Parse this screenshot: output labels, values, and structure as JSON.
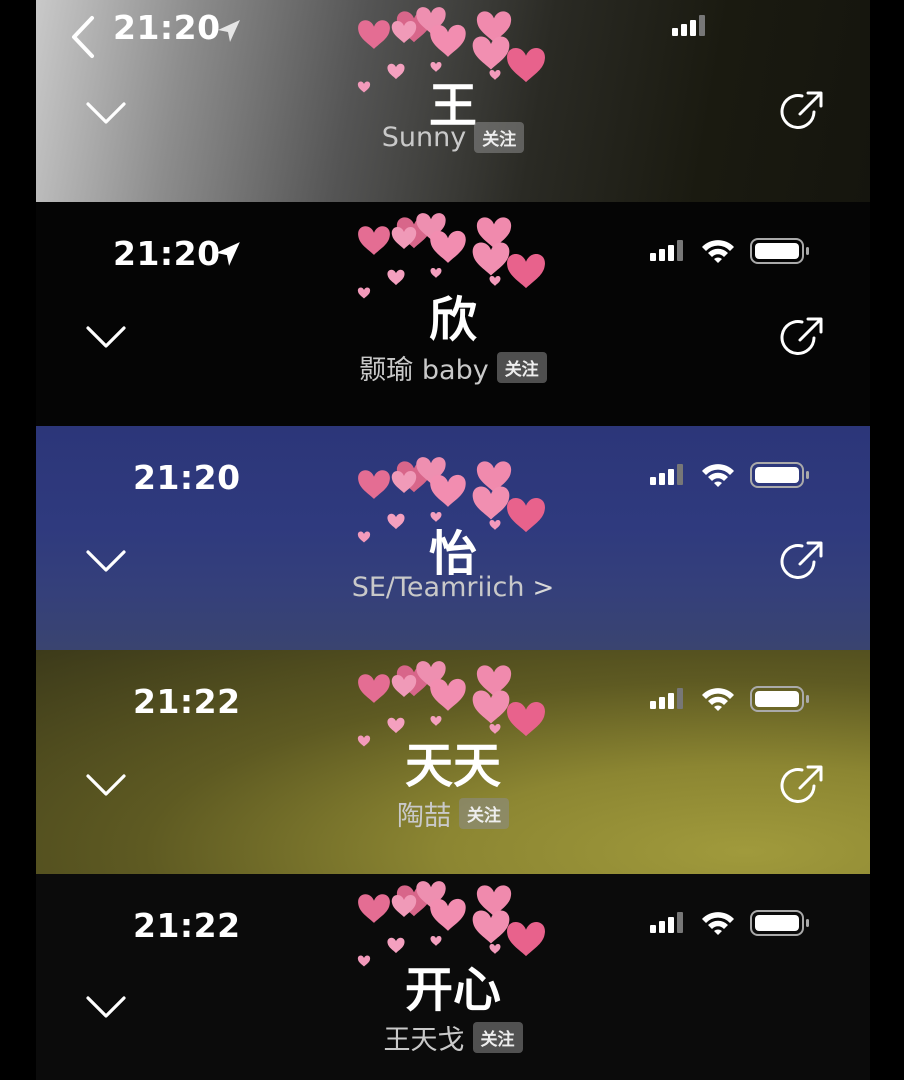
{
  "cards": [
    {
      "time": "21:20",
      "name": "王",
      "subtitle": "Sunny",
      "badge": "关注"
    },
    {
      "time": "21:20",
      "name": "欣",
      "subtitle": "颢瑜 baby",
      "badge": "关注"
    },
    {
      "time": "21:20",
      "name": "怡",
      "subtitle": "SE/Teamriich",
      "arrow": ">"
    },
    {
      "time": "21:22",
      "name": "天天",
      "subtitle": "陶喆",
      "badge": "关注"
    },
    {
      "time": "21:22",
      "name": "开心",
      "subtitle": "王天戈",
      "badge": "关注"
    }
  ],
  "colors": {
    "heart": "#ea6f96",
    "heart_light": "#f3a2bd",
    "subtitle": "#c9c9c9"
  }
}
